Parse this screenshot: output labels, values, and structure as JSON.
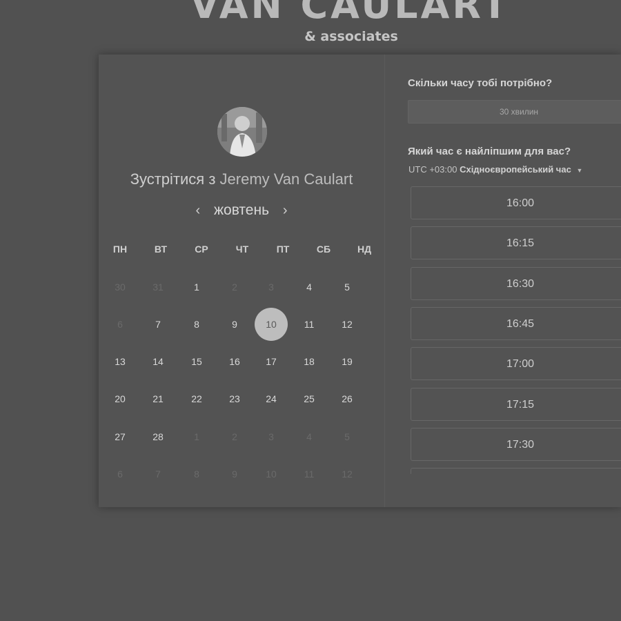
{
  "brand": {
    "title": "VAN CAULART",
    "subtitle": "& associates"
  },
  "calendar": {
    "meet_prefix": "Зустрітися з",
    "host_name": "Jeremy Van Caulart",
    "month": "жовтень",
    "weekdays": [
      "ПН",
      "ВТ",
      "СР",
      "ЧТ",
      "ПТ",
      "СБ",
      "НД"
    ],
    "weeks": [
      [
        "30",
        "31",
        "1",
        "2",
        "3",
        "4",
        "5"
      ],
      [
        "6",
        "7",
        "8",
        "9",
        "10",
        "11",
        "12"
      ],
      [
        "13",
        "14",
        "15",
        "16",
        "17",
        "18",
        "19"
      ],
      [
        "20",
        "21",
        "22",
        "23",
        "24",
        "25",
        "26"
      ],
      [
        "27",
        "28",
        "1",
        "2",
        "3",
        "4",
        "5"
      ],
      [
        "6",
        "7",
        "8",
        "9",
        "10",
        "11",
        "12"
      ]
    ],
    "muted": [
      [
        true,
        true,
        false,
        true,
        true,
        false,
        false
      ],
      [
        true,
        false,
        false,
        false,
        false,
        false,
        false
      ],
      [
        false,
        false,
        false,
        false,
        false,
        false,
        false
      ],
      [
        false,
        false,
        false,
        false,
        false,
        false,
        false
      ],
      [
        false,
        false,
        true,
        true,
        true,
        true,
        true
      ],
      [
        true,
        true,
        true,
        true,
        true,
        true,
        true
      ]
    ],
    "selected_day": "10"
  },
  "booking": {
    "duration_question": "Скільки часу тобі потрібно?",
    "duration_value": "30 хвилин",
    "time_question": "Який час є найліпшим для вас?",
    "timezone_offset": "UTC +03:00",
    "timezone_name": "Східноєвропейський час",
    "slots": [
      "16:00",
      "16:15",
      "16:30",
      "16:45",
      "17:00",
      "17:15",
      "17:30",
      ""
    ]
  }
}
